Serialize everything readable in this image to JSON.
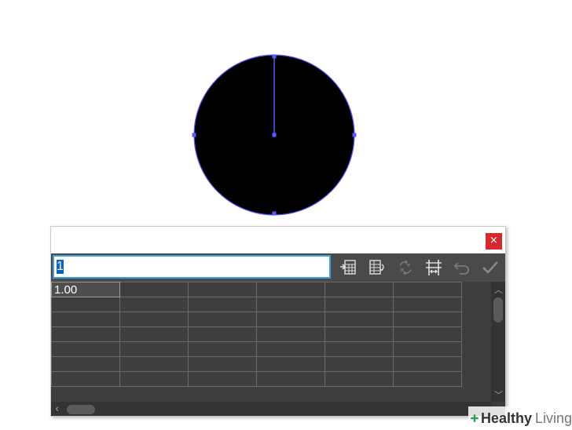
{
  "canvas": {
    "pie": {
      "fill": "#000000",
      "outline": "#5a5aff",
      "radius_line": true,
      "anchor_points": [
        "top",
        "left",
        "right",
        "bottom",
        "center"
      ]
    }
  },
  "dialog": {
    "close_label": "×",
    "close_color": "#d7282f",
    "value_input": "1",
    "toolbar": [
      {
        "name": "import-data-icon",
        "enabled": true
      },
      {
        "name": "transpose-icon",
        "enabled": true
      },
      {
        "name": "switch-xy-icon",
        "enabled": false
      },
      {
        "name": "cell-style-icon",
        "enabled": true
      },
      {
        "name": "revert-icon",
        "enabled": false
      },
      {
        "name": "apply-icon",
        "enabled": false
      }
    ],
    "grid": {
      "columns": 6,
      "rows": 7,
      "cells": [
        [
          "1.00"
        ]
      ]
    }
  },
  "watermark": {
    "strong": "Healthy",
    "light": "Living"
  }
}
